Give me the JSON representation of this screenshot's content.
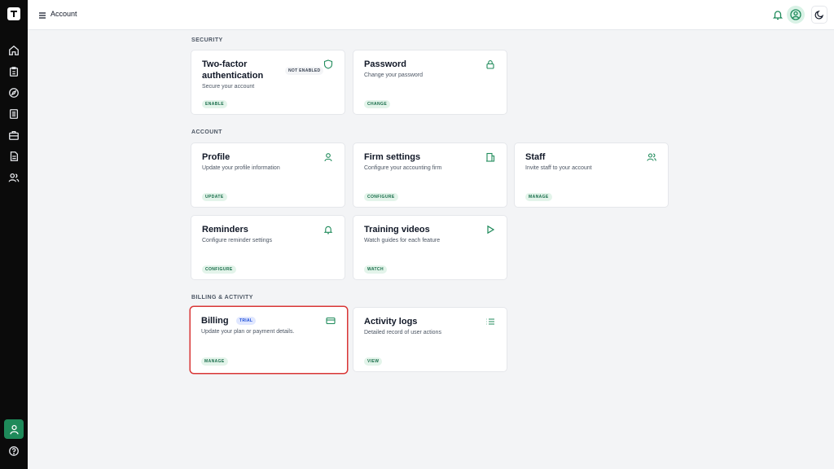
{
  "header": {
    "title": "Account"
  },
  "colors": {
    "accent": "#1e8a5a",
    "action_text": "#166b48",
    "highlight": "#d93636",
    "sidebar_bg": "#0b0b0b"
  },
  "sidebar": {
    "items": [
      {
        "icon": "home-icon"
      },
      {
        "icon": "clipboard-icon"
      },
      {
        "icon": "compass-icon"
      },
      {
        "icon": "document-list-icon"
      },
      {
        "icon": "briefcase-icon"
      },
      {
        "icon": "file-text-icon"
      },
      {
        "icon": "users-icon"
      }
    ],
    "bottom": [
      {
        "icon": "user-icon",
        "active": true
      },
      {
        "icon": "help-icon"
      }
    ]
  },
  "sections": {
    "security": {
      "label": "SECURITY",
      "cards": {
        "two_factor": {
          "title": "Two-factor authentication",
          "description": "Secure your account",
          "action": "ENABLE",
          "badge": "NOT ENABLED",
          "icon": "shield-icon"
        },
        "password": {
          "title": "Password",
          "description": "Change your password",
          "action": "CHANGE",
          "icon": "lock-icon"
        }
      }
    },
    "account": {
      "label": "ACCOUNT",
      "cards": {
        "profile": {
          "title": "Profile",
          "description": "Update your profile information",
          "action": "UPDATE",
          "icon": "user-icon"
        },
        "firm": {
          "title": "Firm settings",
          "description": "Configure your accounting firm",
          "action": "CONFIGURE",
          "icon": "building-icon"
        },
        "staff": {
          "title": "Staff",
          "description": "Invite staff to your account",
          "action": "MANAGE",
          "icon": "users-icon"
        },
        "reminders": {
          "title": "Reminders",
          "description": "Configure reminder settings",
          "action": "CONFIGURE",
          "icon": "bell-icon"
        },
        "training": {
          "title": "Training videos",
          "description": "Watch guides for each feature",
          "action": "WATCH",
          "icon": "play-icon"
        }
      }
    },
    "billing": {
      "label": "BILLING & ACTIVITY",
      "cards": {
        "billing": {
          "title": "Billing",
          "description": "Update your plan or payment details.",
          "action": "MANAGE",
          "badge": "TRIAL",
          "icon": "credit-card-icon"
        },
        "activity": {
          "title": "Activity logs",
          "description": "Detailed record of user actions",
          "action": "VIEW",
          "icon": "list-icon"
        }
      }
    }
  }
}
